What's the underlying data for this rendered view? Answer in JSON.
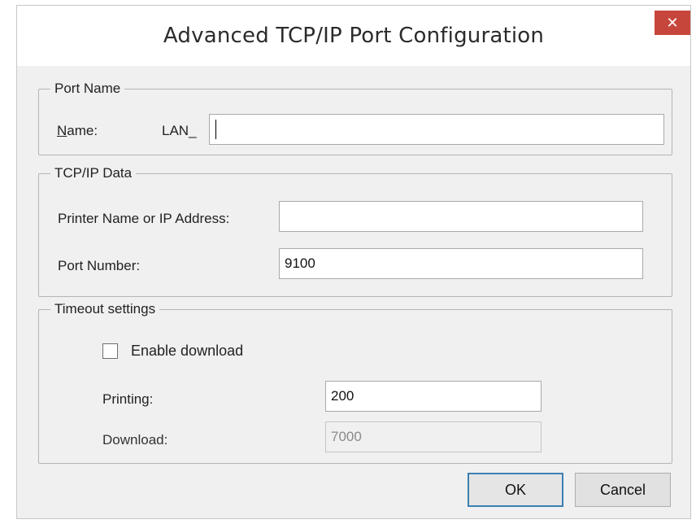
{
  "window": {
    "title": "Advanced TCP/IP Port Configuration",
    "close_glyph": "✕"
  },
  "port_name": {
    "group_label": "Port Name",
    "name_label_access": "N",
    "name_label_rest": "ame:",
    "prefix": "LAN_",
    "value": ""
  },
  "tcpip_data": {
    "group_label": "TCP/IP Data",
    "printer_label": "Printer Name or IP Address:",
    "printer_value": "",
    "port_label": "Port Number:",
    "port_value": "9100"
  },
  "timeout": {
    "group_label": "Timeout settings",
    "enable_download_label": "Enable download",
    "enable_download_checked": false,
    "printing_label": "Printing:",
    "printing_value": "200",
    "download_label": "Download:",
    "download_value": "7000"
  },
  "buttons": {
    "ok": "OK",
    "cancel": "Cancel"
  },
  "colors": {
    "close_button": "#c7463b",
    "default_button_border": "#3c7fb1",
    "dialog_background": "#f0f0f0"
  }
}
